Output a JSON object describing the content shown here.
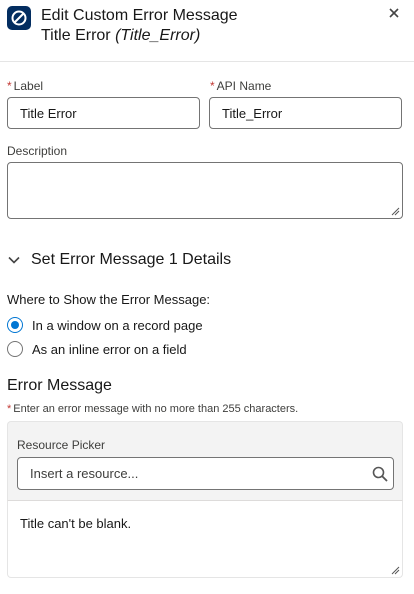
{
  "header": {
    "title": "Edit Custom Error Message",
    "subtitle_label": "Title Error",
    "subtitle_api": "(Title_Error)",
    "app_icon": "prohibited-icon",
    "close_icon": "close-icon"
  },
  "fields": {
    "label": {
      "required_mark": "*",
      "caption": "Label",
      "value": "Title Error"
    },
    "api_name": {
      "required_mark": "*",
      "caption": "API Name",
      "value": "Title_Error"
    },
    "description": {
      "caption": "Description",
      "value": ""
    }
  },
  "section": {
    "title": "Set Error Message 1 Details",
    "toggle_icon": "chevron-down-icon",
    "expanded": true
  },
  "where_to_show": {
    "caption": "Where to Show the Error Message:",
    "options": [
      {
        "label": "In a window on a record page",
        "checked": true
      },
      {
        "label": "As an inline error on a field",
        "checked": false
      }
    ]
  },
  "error_message": {
    "title": "Error Message",
    "required_mark": "*",
    "hint": "Enter an error message with no more than 255 characters.",
    "resource_picker": {
      "label": "Resource Picker",
      "placeholder": "Insert a resource...",
      "search_icon": "search-icon"
    },
    "message_text": "Title can't be blank."
  },
  "colors": {
    "brand_icon_bg": "#032d60",
    "accent": "#0176d3",
    "required": "#c23934",
    "border": "#747474"
  }
}
